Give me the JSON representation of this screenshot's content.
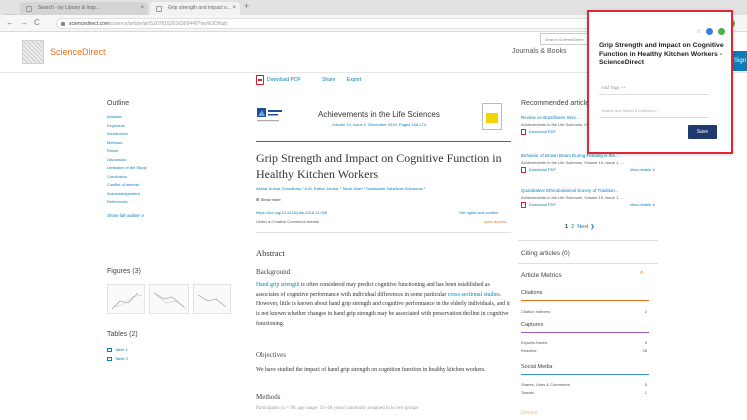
{
  "browser": {
    "tabs": [
      {
        "label": "Search - by Library & Insp..."
      },
      {
        "label": "Grip strength and impact o..."
      }
    ],
    "new_tab": "+",
    "url_host": "sciencedirect.com",
    "url_path": "/science/article/pii/S2078152016300449?via%3Dihub",
    "back": "←",
    "forward": "→",
    "reload": "C",
    "star": "☆"
  },
  "site": {
    "brand": "ScienceDirect",
    "journals_link": "Journals & Books",
    "search_placeholder": "Search ScienceDirect",
    "signin": "Sign in"
  },
  "toolbar": {
    "download_pdf": "Download PDF",
    "share": "Share",
    "export": "Export"
  },
  "outline": {
    "heading": "Outline",
    "items": [
      "Abstract",
      "Keywords",
      "Introduction",
      "Methods",
      "Result",
      "Discussion",
      "Limitation of the Study",
      "Conclusion",
      "Conflict of interest",
      "Acknowledgement",
      "References"
    ],
    "show_full": "Show full outline ∨",
    "figures_heading": "Figures (3)",
    "tables_heading": "Tables (2)",
    "tables": [
      "Table 1",
      "Table 2"
    ]
  },
  "article": {
    "journal": "Achievements in the Life Sciences",
    "journal_meta": "Volume 10, Issue 2, December 2016, Pages 168-174",
    "title": "Grip Strength and Impact on Cognitive Function in Healthy Kitchen Workers",
    "authors": "Akhtar Kumar Choudhary ¹ A.M. Rabiul Jaunar ¹ Tanvir Alam ¹ Sadawarte Sahebrao Kishanrao ¹",
    "show_more": "⊞ Show more",
    "doi": "https://doi.org/10.1016/j.als.2016.11.008",
    "license": "Under a Creative Commons license",
    "rights": "Get rights and content",
    "open_access": "open access",
    "abstract_heading": "Abstract",
    "background_heading": "Background",
    "background_link": "Hand grip strength",
    "background_text": " is often considered may predict cognitive functioning and has been established as associates of cognitive performance with individual differences in some particular ",
    "background_link2": "cross-sectional studies",
    "background_text2": ". However, little is known about hand grip strength and cognitive performance in the elderly individuals, and it is not known whether changes in hand grip strength may be associated with preservation/decline in cognitive functioning.",
    "objectives_heading": "Objectives",
    "objectives_text": "We have studied the impact of hand grip strength on cognition function in healthy kitchen workers.",
    "methods_heading": "Methods",
    "methods_text": "Participants (n = 90, age range: 35–40 years) randomly assigned in to two groups"
  },
  "right": {
    "recommended_heading": "Recommended articles",
    "recommended": [
      {
        "title": "Review on Brazilfoxes Serv...",
        "source": "Achievements in the Life Sciences, Volume 10, Issue 1, ...",
        "pdf": "Download PDF",
        "details": "View details ∨"
      },
      {
        "title": "Behavior of Brown Bears During Feeding in the...",
        "source": "Achievements in the Life Sciences, Volume 10, Issue 1, ...",
        "pdf": "Download PDF",
        "details": "View details ∨"
      },
      {
        "title": "Quantitative Ethnobotanical Survey of Tradition...",
        "source": "Achievements in the Life Sciences, Volume 10, Issue 1, ...",
        "pdf": "Download PDF",
        "details": "View details ∨"
      }
    ],
    "pager": {
      "p1": "1",
      "p2": "2",
      "next": "Next ❯"
    },
    "citing": "Citing articles (0)",
    "metrics_heading": "Article Metrics",
    "metrics_caret": "^",
    "citations_label": "Citations",
    "citation_indexes": "Citation Indexes:",
    "citation_indexes_v": "2",
    "captures_label": "Captures",
    "exports_saves": "Exports-Saves:",
    "exports_saves_v": "9",
    "readers": "Readers:",
    "readers_v": "26",
    "social_label": "Social Media",
    "shares": "Shares, Likes & Comments:",
    "shares_v": "5",
    "tweets": "Tweets:",
    "tweets_v": "1",
    "faded": "Groups"
  },
  "popup": {
    "title": "Grip Strength and Impact on Cognitive Function in Healthy Kitchen Workers - ScienceDirect",
    "tags_placeholder": "Add Tags ++",
    "collection_placeholder": "Search and Select a Collection...",
    "save": "Save"
  },
  "colors": {
    "accent": "#0c7dbb",
    "brand_orange": "#e9711c",
    "highlight_border": "#e0273a",
    "save_button": "#1e3a6e"
  }
}
